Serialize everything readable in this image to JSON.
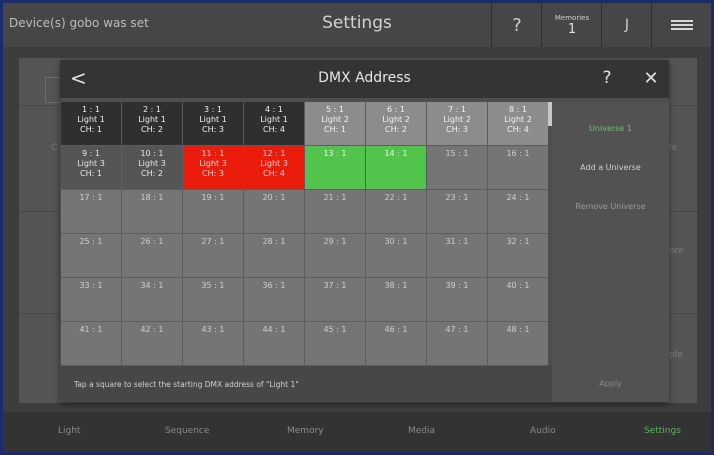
{
  "topbar": {
    "status": "Device(s) gobo was set",
    "title": "Settings",
    "help": "?",
    "memories_label": "Memories",
    "memories_count": "1",
    "user": "J"
  },
  "background": {
    "right_label_1": "le",
    "right_label_2": "ore",
    "right_label_3": "ple",
    "left_label_1": "C"
  },
  "modal": {
    "title": "DMX Address",
    "back": "<",
    "help": "?",
    "close": "✕",
    "cells": [
      {
        "addr": "1 : 1",
        "light": "Light 1",
        "ch": "CH: 1",
        "state": "d1"
      },
      {
        "addr": "2 : 1",
        "light": "Light 1",
        "ch": "CH: 2",
        "state": "d1"
      },
      {
        "addr": "3 : 1",
        "light": "Light 1",
        "ch": "CH: 3",
        "state": "d1"
      },
      {
        "addr": "4 : 1",
        "light": "Light 1",
        "ch": "CH: 4",
        "state": "d1"
      },
      {
        "addr": "5 : 1",
        "light": "Light 2",
        "ch": "CH: 1",
        "state": "d2"
      },
      {
        "addr": "6 : 1",
        "light": "Light 2",
        "ch": "CH: 2",
        "state": "d2"
      },
      {
        "addr": "7 : 1",
        "light": "Light 2",
        "ch": "CH: 3",
        "state": "d2"
      },
      {
        "addr": "8 : 1",
        "light": "Light 2",
        "ch": "CH: 4",
        "state": "d2"
      },
      {
        "addr": "9 : 1",
        "light": "Light 3",
        "ch": "CH: 1",
        "state": "d3"
      },
      {
        "addr": "10 : 1",
        "light": "Light 3",
        "ch": "CH: 2",
        "state": "d3"
      },
      {
        "addr": "11 : 1",
        "light": "Light 3",
        "ch": "CH: 3",
        "state": "sel"
      },
      {
        "addr": "12 : 1",
        "light": "Light 3",
        "ch": "CH: 4",
        "state": "sel"
      },
      {
        "addr": "13 : 1",
        "light": "",
        "ch": "",
        "state": "grn"
      },
      {
        "addr": "14 : 1",
        "light": "",
        "ch": "",
        "state": "grn"
      },
      {
        "addr": "15 : 1",
        "light": "",
        "ch": "",
        "state": "free"
      },
      {
        "addr": "16 : 1",
        "light": "",
        "ch": "",
        "state": "free"
      },
      {
        "addr": "17 : 1",
        "light": "",
        "ch": "",
        "state": "free"
      },
      {
        "addr": "18 : 1",
        "light": "",
        "ch": "",
        "state": "free"
      },
      {
        "addr": "19 : 1",
        "light": "",
        "ch": "",
        "state": "free"
      },
      {
        "addr": "20 : 1",
        "light": "",
        "ch": "",
        "state": "free"
      },
      {
        "addr": "21 : 1",
        "light": "",
        "ch": "",
        "state": "free"
      },
      {
        "addr": "22 : 1",
        "light": "",
        "ch": "",
        "state": "free"
      },
      {
        "addr": "23 : 1",
        "light": "",
        "ch": "",
        "state": "free"
      },
      {
        "addr": "24 : 1",
        "light": "",
        "ch": "",
        "state": "free"
      },
      {
        "addr": "25 : 1",
        "light": "",
        "ch": "",
        "state": "free"
      },
      {
        "addr": "26 : 1",
        "light": "",
        "ch": "",
        "state": "free"
      },
      {
        "addr": "27 : 1",
        "light": "",
        "ch": "",
        "state": "free"
      },
      {
        "addr": "28 : 1",
        "light": "",
        "ch": "",
        "state": "free"
      },
      {
        "addr": "29 : 1",
        "light": "",
        "ch": "",
        "state": "free"
      },
      {
        "addr": "30 : 1",
        "light": "",
        "ch": "",
        "state": "free"
      },
      {
        "addr": "31 : 1",
        "light": "",
        "ch": "",
        "state": "free"
      },
      {
        "addr": "32 : 1",
        "light": "",
        "ch": "",
        "state": "free"
      },
      {
        "addr": "33 : 1",
        "light": "",
        "ch": "",
        "state": "free"
      },
      {
        "addr": "34 : 1",
        "light": "",
        "ch": "",
        "state": "free"
      },
      {
        "addr": "35 : 1",
        "light": "",
        "ch": "",
        "state": "free"
      },
      {
        "addr": "36 : 1",
        "light": "",
        "ch": "",
        "state": "free"
      },
      {
        "addr": "37 : 1",
        "light": "",
        "ch": "",
        "state": "free"
      },
      {
        "addr": "38 : 1",
        "light": "",
        "ch": "",
        "state": "free"
      },
      {
        "addr": "39 : 1",
        "light": "",
        "ch": "",
        "state": "free"
      },
      {
        "addr": "40 : 1",
        "light": "",
        "ch": "",
        "state": "free"
      },
      {
        "addr": "41 : 1",
        "light": "",
        "ch": "",
        "state": "free"
      },
      {
        "addr": "42 : 1",
        "light": "",
        "ch": "",
        "state": "free"
      },
      {
        "addr": "43 : 1",
        "light": "",
        "ch": "",
        "state": "free"
      },
      {
        "addr": "44 : 1",
        "light": "",
        "ch": "",
        "state": "free"
      },
      {
        "addr": "45 : 1",
        "light": "",
        "ch": "",
        "state": "free"
      },
      {
        "addr": "46 : 1",
        "light": "",
        "ch": "",
        "state": "free"
      },
      {
        "addr": "47 : 1",
        "light": "",
        "ch": "",
        "state": "free"
      },
      {
        "addr": "48 : 1",
        "light": "",
        "ch": "",
        "state": "free"
      }
    ],
    "side": {
      "universe_1": "Universe 1",
      "add_universe": "Add a Universe",
      "remove_universe": "Remove Universe"
    },
    "hint": "Tap a square to select the starting DMX address of \"Light 1\"",
    "apply": "Apply"
  },
  "bottom_nav": {
    "items": [
      "Light",
      "Sequence",
      "Memory",
      "Media",
      "Audio",
      "Settings"
    ],
    "active": "Settings"
  },
  "colors": {
    "selected": "#ec1c0c",
    "available": "#52c44c",
    "accent": "#6fc36a"
  }
}
